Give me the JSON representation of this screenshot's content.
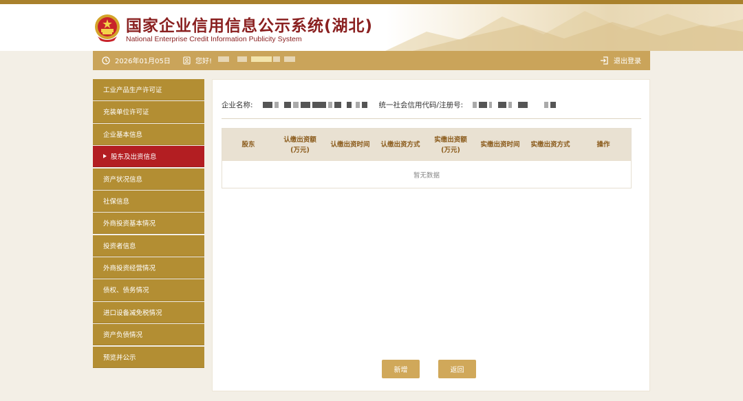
{
  "header": {
    "title": "国家企业信用信息公示系统(湖北)",
    "subtitle": "National Enterprise Credit Information Publicity System"
  },
  "toolbar": {
    "date": "2026年01月05日",
    "greeting": "您好!",
    "logout": "退出登录"
  },
  "sidebar": {
    "items": [
      {
        "label": "工业产品生产许可证"
      },
      {
        "label": "充装单位许可证"
      },
      {
        "label": "企业基本信息"
      },
      {
        "label": "股东及出资信息",
        "active": true
      },
      {
        "label": "资产状况信息"
      },
      {
        "label": "社保信息"
      },
      {
        "label": "外商投资基本情况"
      },
      {
        "label": "投资者信息"
      },
      {
        "label": "外商投资经营情况"
      },
      {
        "label": "债权、债务情况"
      },
      {
        "label": "进口设备减免税情况"
      },
      {
        "label": "资产负债情况"
      },
      {
        "label": "预览并公示"
      }
    ]
  },
  "main": {
    "company_label": "企业名称:",
    "credit_label": "统一社会信用代码/注册号:",
    "table": {
      "headers": [
        "股东",
        "认缴出资额\n(万元)",
        "认缴出资时间",
        "认缴出资方式",
        "实缴出资额\n(万元)",
        "实缴出资时间",
        "实缴出资方式",
        "操作"
      ],
      "empty_text": "暂无数据"
    },
    "buttons": {
      "add": "新增",
      "back": "返回"
    }
  },
  "colors": {
    "brand_gold": "#b38e33",
    "active_red": "#b31e22",
    "toolbar": "#caa45a",
    "title_red": "#8a2020"
  }
}
